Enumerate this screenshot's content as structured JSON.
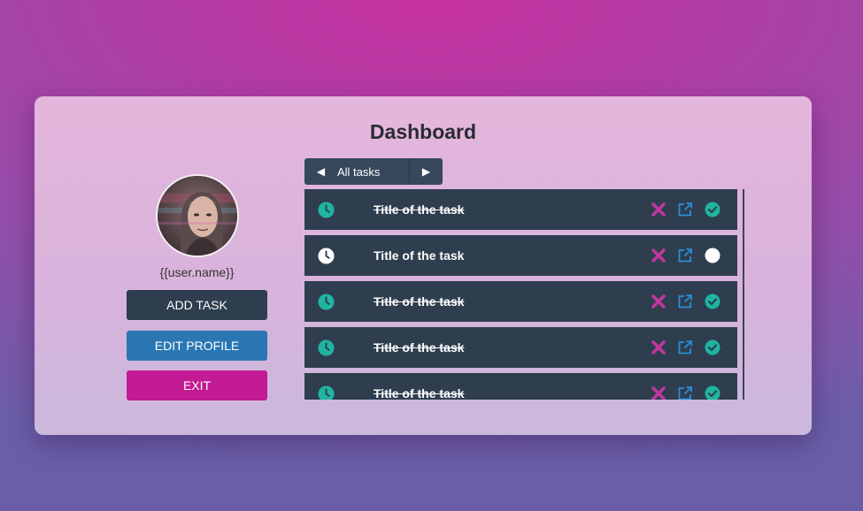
{
  "page": {
    "title": "Dashboard"
  },
  "user": {
    "name": "{{user.name}}"
  },
  "buttons": {
    "add_task": "ADD TASK",
    "edit_profile": "EDIT PROFILE",
    "exit": "EXIT"
  },
  "filter": {
    "label": "All tasks",
    "prev_icon": "triangle-left-icon",
    "next_icon": "triangle-right-icon"
  },
  "colors": {
    "accent_teal": "#1fb5a0",
    "delete_magenta": "#c2369e",
    "link_blue": "#2a8fd6",
    "row_bg": "#2e3e4f",
    "edit_btn": "#2a77b4",
    "exit_btn": "#c21b93"
  },
  "tasks": [
    {
      "title": "Title of the task",
      "completed": true
    },
    {
      "title": "Title of the task",
      "completed": false
    },
    {
      "title": "Title of the task",
      "completed": true
    },
    {
      "title": "Title of the task",
      "completed": true
    },
    {
      "title": "Title of the task",
      "completed": true
    }
  ]
}
